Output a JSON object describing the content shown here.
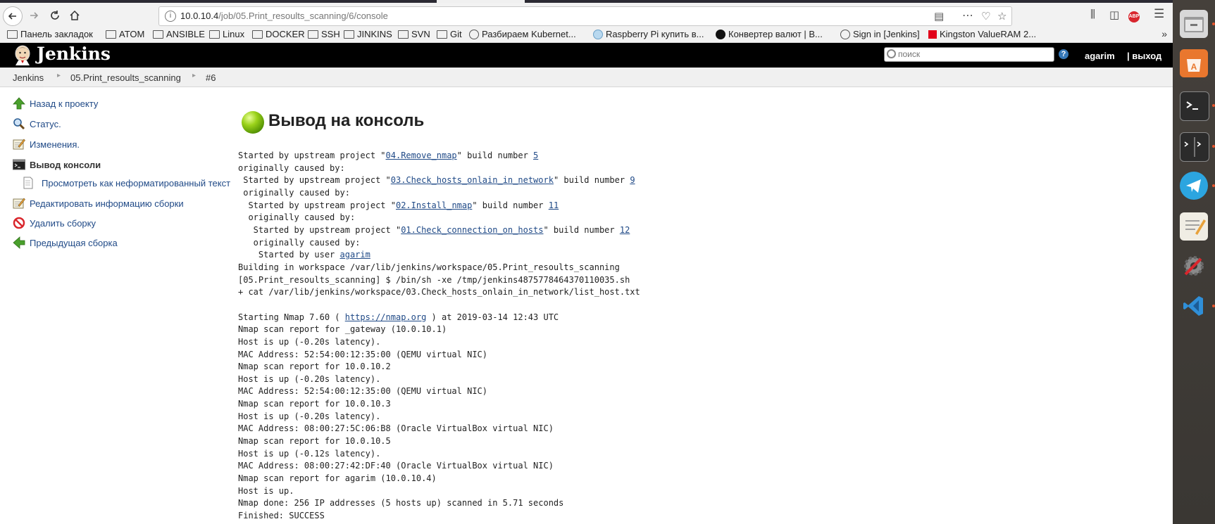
{
  "browser": {
    "url_host": "10.0.10.4",
    "url_path": "/job/05.Print_resoults_scanning/6/console"
  },
  "bookmarks": [
    {
      "label": "Панель закладок",
      "icon": "folder-icon"
    },
    {
      "label": "ATOM",
      "icon": "folder-icon"
    },
    {
      "label": "ANSIBLE",
      "icon": "folder-icon"
    },
    {
      "label": "Linux",
      "icon": "folder-icon"
    },
    {
      "label": "DOCKER",
      "icon": "folder-icon"
    },
    {
      "label": "SSH",
      "icon": "folder-icon"
    },
    {
      "label": "JINKINS",
      "icon": "folder-icon"
    },
    {
      "label": "SVN",
      "icon": "folder-icon"
    },
    {
      "label": "Git",
      "icon": "folder-icon"
    },
    {
      "label": "Разбираем Kubernet...",
      "icon": "globe-icon"
    },
    {
      "label": "Raspberry Pi купить в...",
      "icon": "site-icon"
    },
    {
      "label": "Конвертер валют | В...",
      "icon": "site-icon"
    },
    {
      "label": "Sign in [Jenkins]",
      "icon": "globe-icon"
    },
    {
      "label": "Kingston ValueRAM 2...",
      "icon": "site-icon"
    }
  ],
  "jenkins": {
    "title": "Jenkins",
    "search_placeholder": "поиск",
    "user": "agarim",
    "logout": "| выход"
  },
  "breadcrumbs": [
    "Jenkins",
    "05.Print_resoults_scanning",
    "#6"
  ],
  "tasks": [
    {
      "label": "Назад к проекту",
      "icon": "up-arrow-icon"
    },
    {
      "label": "Статус.",
      "icon": "magnifier-icon"
    },
    {
      "label": "Изменения.",
      "icon": "notepad-icon"
    },
    {
      "label": "Вывод консоли",
      "icon": "terminal-icon"
    },
    {
      "label": "Просмотреть как неформатированный текст",
      "icon": "document-icon"
    },
    {
      "label": "Редактировать информацию сборки",
      "icon": "notepad-icon"
    },
    {
      "label": "Удалить сборку",
      "icon": "no-entry-icon"
    },
    {
      "label": "Предыдущая сборка",
      "icon": "left-arrow-icon"
    }
  ],
  "main": {
    "heading": "Вывод на консоль",
    "status_color": "#7ab800"
  },
  "console_lines": [
    [
      {
        "t": "Started by upstream project \""
      },
      {
        "t": "04.Remove_nmap",
        "link": true
      },
      {
        "t": "\" build number "
      },
      {
        "t": "5",
        "link": true
      }
    ],
    [
      {
        "t": "originally caused by:"
      }
    ],
    [
      {
        "t": " Started by upstream project \""
      },
      {
        "t": "03.Check_hosts_onlain_in_network",
        "link": true
      },
      {
        "t": "\" build number "
      },
      {
        "t": "9",
        "link": true
      }
    ],
    [
      {
        "t": " originally caused by:"
      }
    ],
    [
      {
        "t": "  Started by upstream project \""
      },
      {
        "t": "02.Install_nmap",
        "link": true
      },
      {
        "t": "\" build number "
      },
      {
        "t": "11",
        "link": true
      }
    ],
    [
      {
        "t": "  originally caused by:"
      }
    ],
    [
      {
        "t": "   Started by upstream project \""
      },
      {
        "t": "01.Check_connection_on_hosts",
        "link": true
      },
      {
        "t": "\" build number "
      },
      {
        "t": "12",
        "link": true
      }
    ],
    [
      {
        "t": "   originally caused by:"
      }
    ],
    [
      {
        "t": "    Started by user "
      },
      {
        "t": "agarim",
        "link": true
      }
    ],
    [
      {
        "t": "Building in workspace /var/lib/jenkins/workspace/05.Print_resoults_scanning"
      }
    ],
    [
      {
        "t": "[05.Print_resoults_scanning] $ /bin/sh -xe /tmp/jenkins4875778464370110035.sh"
      }
    ],
    [
      {
        "t": "+ cat /var/lib/jenkins/workspace/03.Check_hosts_onlain_in_network/list_host.txt"
      }
    ],
    [
      {
        "t": ""
      }
    ],
    [
      {
        "t": "Starting Nmap 7.60 ( "
      },
      {
        "t": "https://nmap.org",
        "link": true
      },
      {
        "t": " ) at 2019-03-14 12:43 UTC"
      }
    ],
    [
      {
        "t": "Nmap scan report for _gateway (10.0.10.1)"
      }
    ],
    [
      {
        "t": "Host is up (-0.20s latency)."
      }
    ],
    [
      {
        "t": "MAC Address: 52:54:00:12:35:00 (QEMU virtual NIC)"
      }
    ],
    [
      {
        "t": "Nmap scan report for 10.0.10.2"
      }
    ],
    [
      {
        "t": "Host is up (-0.20s latency)."
      }
    ],
    [
      {
        "t": "MAC Address: 52:54:00:12:35:00 (QEMU virtual NIC)"
      }
    ],
    [
      {
        "t": "Nmap scan report for 10.0.10.3"
      }
    ],
    [
      {
        "t": "Host is up (-0.20s latency)."
      }
    ],
    [
      {
        "t": "MAC Address: 08:00:27:5C:06:B8 (Oracle VirtualBox virtual NIC)"
      }
    ],
    [
      {
        "t": "Nmap scan report for 10.0.10.5"
      }
    ],
    [
      {
        "t": "Host is up (-0.12s latency)."
      }
    ],
    [
      {
        "t": "MAC Address: 08:00:27:42:DF:40 (Oracle VirtualBox virtual NIC)"
      }
    ],
    [
      {
        "t": "Nmap scan report for agarim (10.0.10.4)"
      }
    ],
    [
      {
        "t": "Host is up."
      }
    ],
    [
      {
        "t": "Nmap done: 256 IP addresses (5 hosts up) scanned in 5.71 seconds"
      }
    ],
    [
      {
        "t": "Finished: SUCCESS"
      }
    ]
  ],
  "launcher": [
    {
      "icon": "files-icon"
    },
    {
      "icon": "software-center-icon"
    },
    {
      "icon": "terminal-icon"
    },
    {
      "icon": "split-terminal-icon"
    },
    {
      "icon": "telegram-icon"
    },
    {
      "icon": "text-editor-icon"
    },
    {
      "icon": "settings-icon"
    },
    {
      "icon": "vscode-icon"
    }
  ]
}
